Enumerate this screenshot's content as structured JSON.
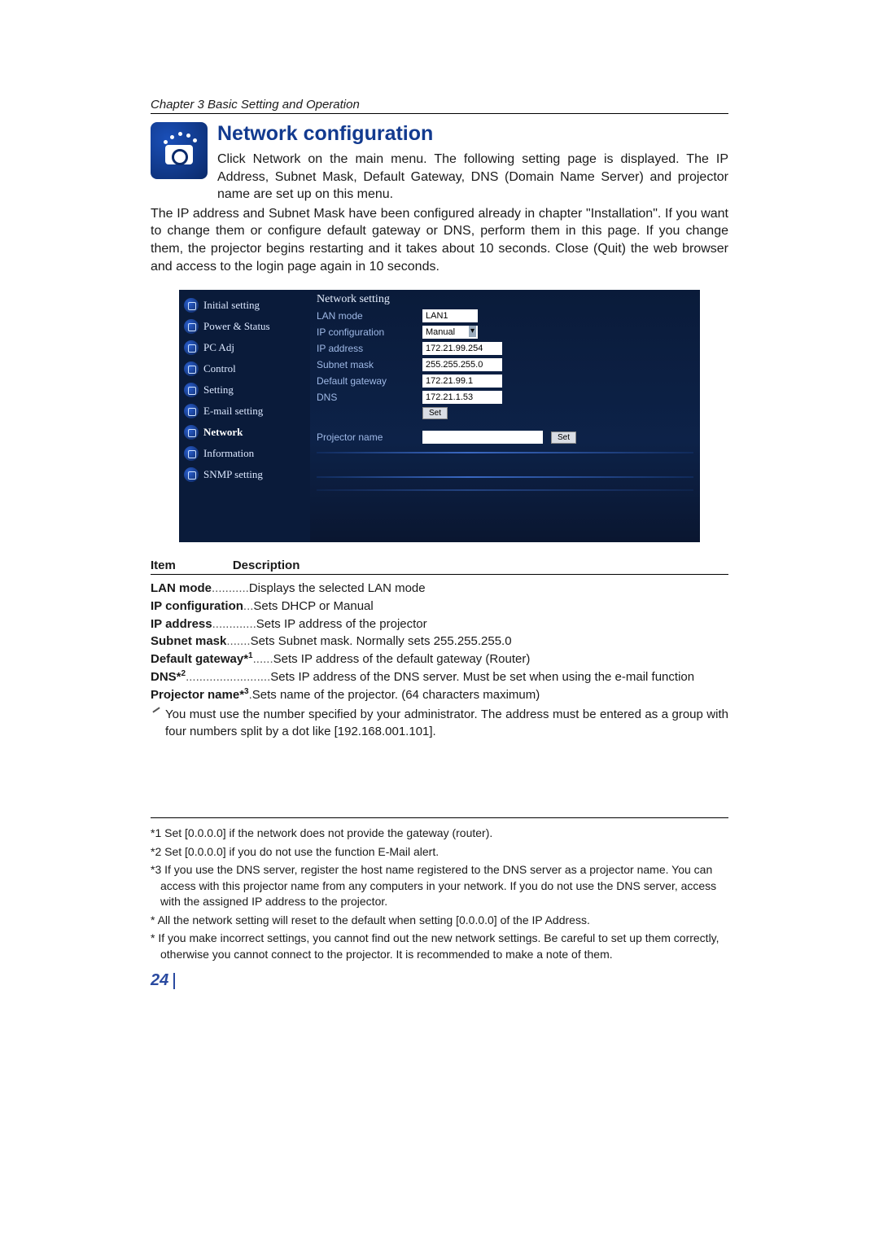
{
  "chapter": "Chapter 3 Basic Setting and Operation",
  "title": "Network configuration",
  "intro1": "Click Network on the main menu. The following setting page is displayed. The IP Address, Subnet Mask, Default Gateway, DNS (Domain Name Server) and projector name are set up on this menu.",
  "intro2": "The IP address and Subnet Mask have been configured already in chapter \"Installation\". If you want to change them or configure default gateway or DNS, perform them in this page. If you change them, the projector begins restarting and it takes about 10 seconds. Close (Quit) the web browser and access to the login page again in 10 seconds.",
  "sidebar": {
    "items": [
      "Initial setting",
      "Power & Status",
      "PC Adj",
      "Control",
      "Setting",
      "E-mail setting",
      "Network",
      "Information",
      "SNMP setting"
    ]
  },
  "panel": {
    "heading": "Network setting",
    "lan_mode_label": "LAN mode",
    "lan_mode_value": "LAN1",
    "ip_conf_label": "IP configuration",
    "ip_conf_value": "Manual",
    "ip_addr_label": "IP address",
    "ip_addr_value": "172.21.99.254",
    "subnet_label": "Subnet mask",
    "subnet_value": "255.255.255.0",
    "gateway_label": "Default gateway",
    "gateway_value": "172.21.99.1",
    "dns_label": "DNS",
    "dns_value": "172.21.1.53",
    "set_btn": "Set",
    "proj_label": "Projector name",
    "proj_value": ""
  },
  "defs_header": {
    "item": "Item",
    "desc": "Description"
  },
  "defs": [
    {
      "term": "LAN mode",
      "conn": "...........",
      "desc": "Displays the selected LAN mode"
    },
    {
      "term": "IP configuration",
      "conn": "...",
      "desc": "Sets DHCP or Manual"
    },
    {
      "term": "IP address",
      "conn": ".............",
      "desc": "Sets IP address of the projector"
    },
    {
      "term": "Subnet mask",
      "conn": ".......",
      "desc": "Sets Subnet mask. Normally sets 255.255.255.0"
    },
    {
      "term": "Default gateway*",
      "sup": "1",
      "conn": "......",
      "desc": "Sets IP address of the default gateway (Router)"
    },
    {
      "term": "DNS*",
      "sup": "2",
      "conn": ".........................",
      "desc": "Sets IP address of the DNS server. Must be set when using the e-mail function"
    },
    {
      "term": "Projector name*",
      "sup": "3",
      "conn": ".",
      "desc": "Sets name of the projector. (64 characters maximum)"
    }
  ],
  "note": "You must use the number specified by your administrator. The address must be entered as a group with four numbers split by a dot like [192.168.001.101].",
  "footnotes": [
    "*1 Set [0.0.0.0] if the network does not provide the gateway (router).",
    "*2 Set [0.0.0.0] if you do not use the function E-Mail alert.",
    "*3 If you use the DNS server, register the host name registered to the DNS server as a projector name. You can access with this projector name from any computers in your network. If you do not use the DNS server, access with the assigned IP address to the projector.",
    "* All the network setting will reset to the default when setting [0.0.0.0] of the IP Address.",
    "* If you make incorrect settings, you cannot find out the new network settings. Be careful to set up them correctly, otherwise you cannot connect to the projector. It is recommended to make a note of them."
  ],
  "page_number": "24"
}
